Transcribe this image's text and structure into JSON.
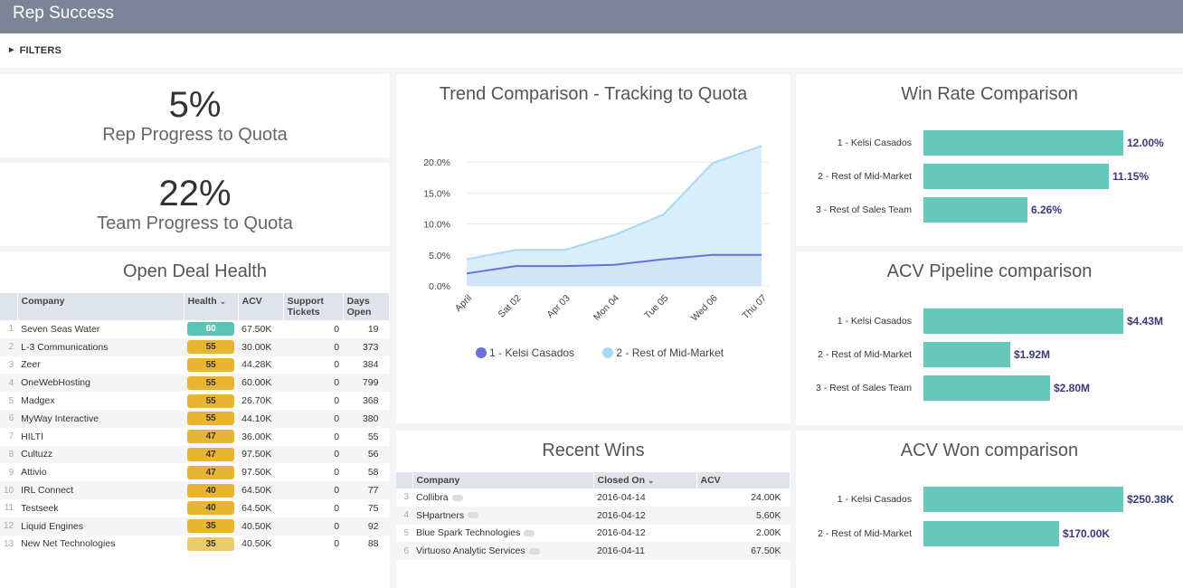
{
  "app": {
    "title": "Rep Success"
  },
  "filters": {
    "label": "FILTERS"
  },
  "kpis": [
    {
      "value": "5%",
      "label": "Rep Progress to Quota"
    },
    {
      "value": "22%",
      "label": "Team Progress to Quota"
    }
  ],
  "open_deal_health": {
    "title": "Open Deal Health",
    "columns": [
      "Company",
      "Health",
      "ACV",
      "Support Tickets",
      "Days Open"
    ],
    "health_sort_icon": "chevron-down-icon",
    "rows": [
      {
        "idx": "1",
        "company": "Seven Seas Water",
        "health": "60",
        "acv": "67.50K",
        "tickets": "0",
        "days": "19"
      },
      {
        "idx": "2",
        "company": "L-3 Communications",
        "health": "55",
        "acv": "30.00K",
        "tickets": "0",
        "days": "373"
      },
      {
        "idx": "3",
        "company": "Zeer",
        "health": "55",
        "acv": "44.28K",
        "tickets": "0",
        "days": "384"
      },
      {
        "idx": "4",
        "company": "OneWebHosting",
        "health": "55",
        "acv": "60.00K",
        "tickets": "0",
        "days": "799"
      },
      {
        "idx": "5",
        "company": "Madgex",
        "health": "55",
        "acv": "26.70K",
        "tickets": "0",
        "days": "368"
      },
      {
        "idx": "6",
        "company": "MyWay Interactive",
        "health": "55",
        "acv": "44.10K",
        "tickets": "0",
        "days": "380"
      },
      {
        "idx": "7",
        "company": "HILTI",
        "health": "47",
        "acv": "36.00K",
        "tickets": "0",
        "days": "55"
      },
      {
        "idx": "8",
        "company": "Cultuzz",
        "health": "47",
        "acv": "97.50K",
        "tickets": "0",
        "days": "56"
      },
      {
        "idx": "9",
        "company": "Attivio",
        "health": "47",
        "acv": "97.50K",
        "tickets": "0",
        "days": "58"
      },
      {
        "idx": "10",
        "company": "IRL Connect",
        "health": "40",
        "acv": "64.50K",
        "tickets": "0",
        "days": "77"
      },
      {
        "idx": "11",
        "company": "Testseek",
        "health": "40",
        "acv": "64.50K",
        "tickets": "0",
        "days": "75"
      },
      {
        "idx": "12",
        "company": "Liquid Engines",
        "health": "35",
        "acv": "40.50K",
        "tickets": "0",
        "days": "92"
      },
      {
        "idx": "13",
        "company": "New Net Technologies",
        "health": "35",
        "acv": "40.50K",
        "tickets": "0",
        "days": "88"
      }
    ],
    "colors": {
      "high": "#5cc4b4",
      "mid": "#e8b533"
    }
  },
  "trend": {
    "title": "Trend Comparison - Tracking to Quota",
    "legend": [
      "1 - Kelsi Casados",
      "2 - Rest of Mid-Market"
    ],
    "colors": {
      "series1": "#6b6fd6",
      "series2": "#a9d8ef"
    }
  },
  "recent_wins": {
    "title": "Recent Wins",
    "columns": [
      "Company",
      "Closed On",
      "ACV"
    ],
    "rows": [
      {
        "idx": "3",
        "company": "Collibra",
        "closed": "2016-04-14",
        "acv": "24.00K"
      },
      {
        "idx": "4",
        "company": "SHpartners",
        "closed": "2016-04-12",
        "acv": "5.60K"
      },
      {
        "idx": "5",
        "company": "Blue Spark Technologies",
        "closed": "2016-04-12",
        "acv": "2.00K"
      },
      {
        "idx": "6",
        "company": "Virtuoso Analytic Services",
        "closed": "2016-04-11",
        "acv": "67.50K"
      }
    ]
  },
  "win_rate": {
    "title": "Win Rate Comparison",
    "bars": [
      {
        "label": "1 - Kelsi Casados",
        "value": 12.0,
        "display": "12.00%"
      },
      {
        "label": "2 - Rest of Mid-Market",
        "value": 11.15,
        "display": "11.15%"
      },
      {
        "label": "3 - Rest of Sales Team",
        "value": 6.26,
        "display": "6.26%"
      }
    ],
    "max": 12.0
  },
  "acv_pipeline": {
    "title": "ACV Pipeline comparison",
    "bars": [
      {
        "label": "1 - Kelsi Casados",
        "value": 4.43,
        "display": "$4.43M"
      },
      {
        "label": "2 - Rest of Mid-Market",
        "value": 1.92,
        "display": "$1.92M"
      },
      {
        "label": "3 - Rest of Sales Team",
        "value": 2.8,
        "display": "$2.80M"
      }
    ],
    "max": 4.43
  },
  "acv_won": {
    "title": "ACV Won comparison",
    "bars": [
      {
        "label": "1 - Kelsi Casados",
        "value": 250.38,
        "display": "$250.38K"
      },
      {
        "label": "2 - Rest of Mid-Market",
        "value": 170.0,
        "display": "$170.00K"
      }
    ],
    "max": 250.38
  },
  "chart_data": [
    {
      "type": "area",
      "title": "Trend Comparison - Tracking to Quota",
      "x": [
        "April",
        "Sat 02",
        "Apr 03",
        "Mon 04",
        "Tue 05",
        "Wed 06",
        "Thu 07"
      ],
      "yticks": [
        "0.0%",
        "5.0%",
        "10.0%",
        "15.0%",
        "20.0%"
      ],
      "ylim": [
        0,
        22.5
      ],
      "series": [
        {
          "name": "1 - Kelsi Casados",
          "values": [
            2.0,
            3.2,
            3.2,
            3.4,
            4.3,
            5.0,
            5.0
          ]
        },
        {
          "name": "2 - Rest of Mid-Market",
          "values": [
            4.3,
            5.8,
            5.8,
            8.2,
            11.5,
            19.8,
            22.6
          ]
        }
      ],
      "legend": "bottom",
      "grid": true
    },
    {
      "type": "bar",
      "title": "Win Rate Comparison",
      "categories": [
        "1 - Kelsi Casados",
        "2 - Rest of Mid-Market",
        "3 - Rest of Sales Team"
      ],
      "values": [
        12.0,
        11.15,
        6.26
      ]
    },
    {
      "type": "bar",
      "title": "ACV Pipeline comparison",
      "categories": [
        "1 - Kelsi Casados",
        "2 - Rest of Mid-Market",
        "3 - Rest of Sales Team"
      ],
      "values": [
        4.43,
        1.92,
        2.8
      ]
    },
    {
      "type": "bar",
      "title": "ACV Won comparison",
      "categories": [
        "1 - Kelsi Casados",
        "2 - Rest of Mid-Market"
      ],
      "values": [
        250.38,
        170.0
      ]
    }
  ]
}
